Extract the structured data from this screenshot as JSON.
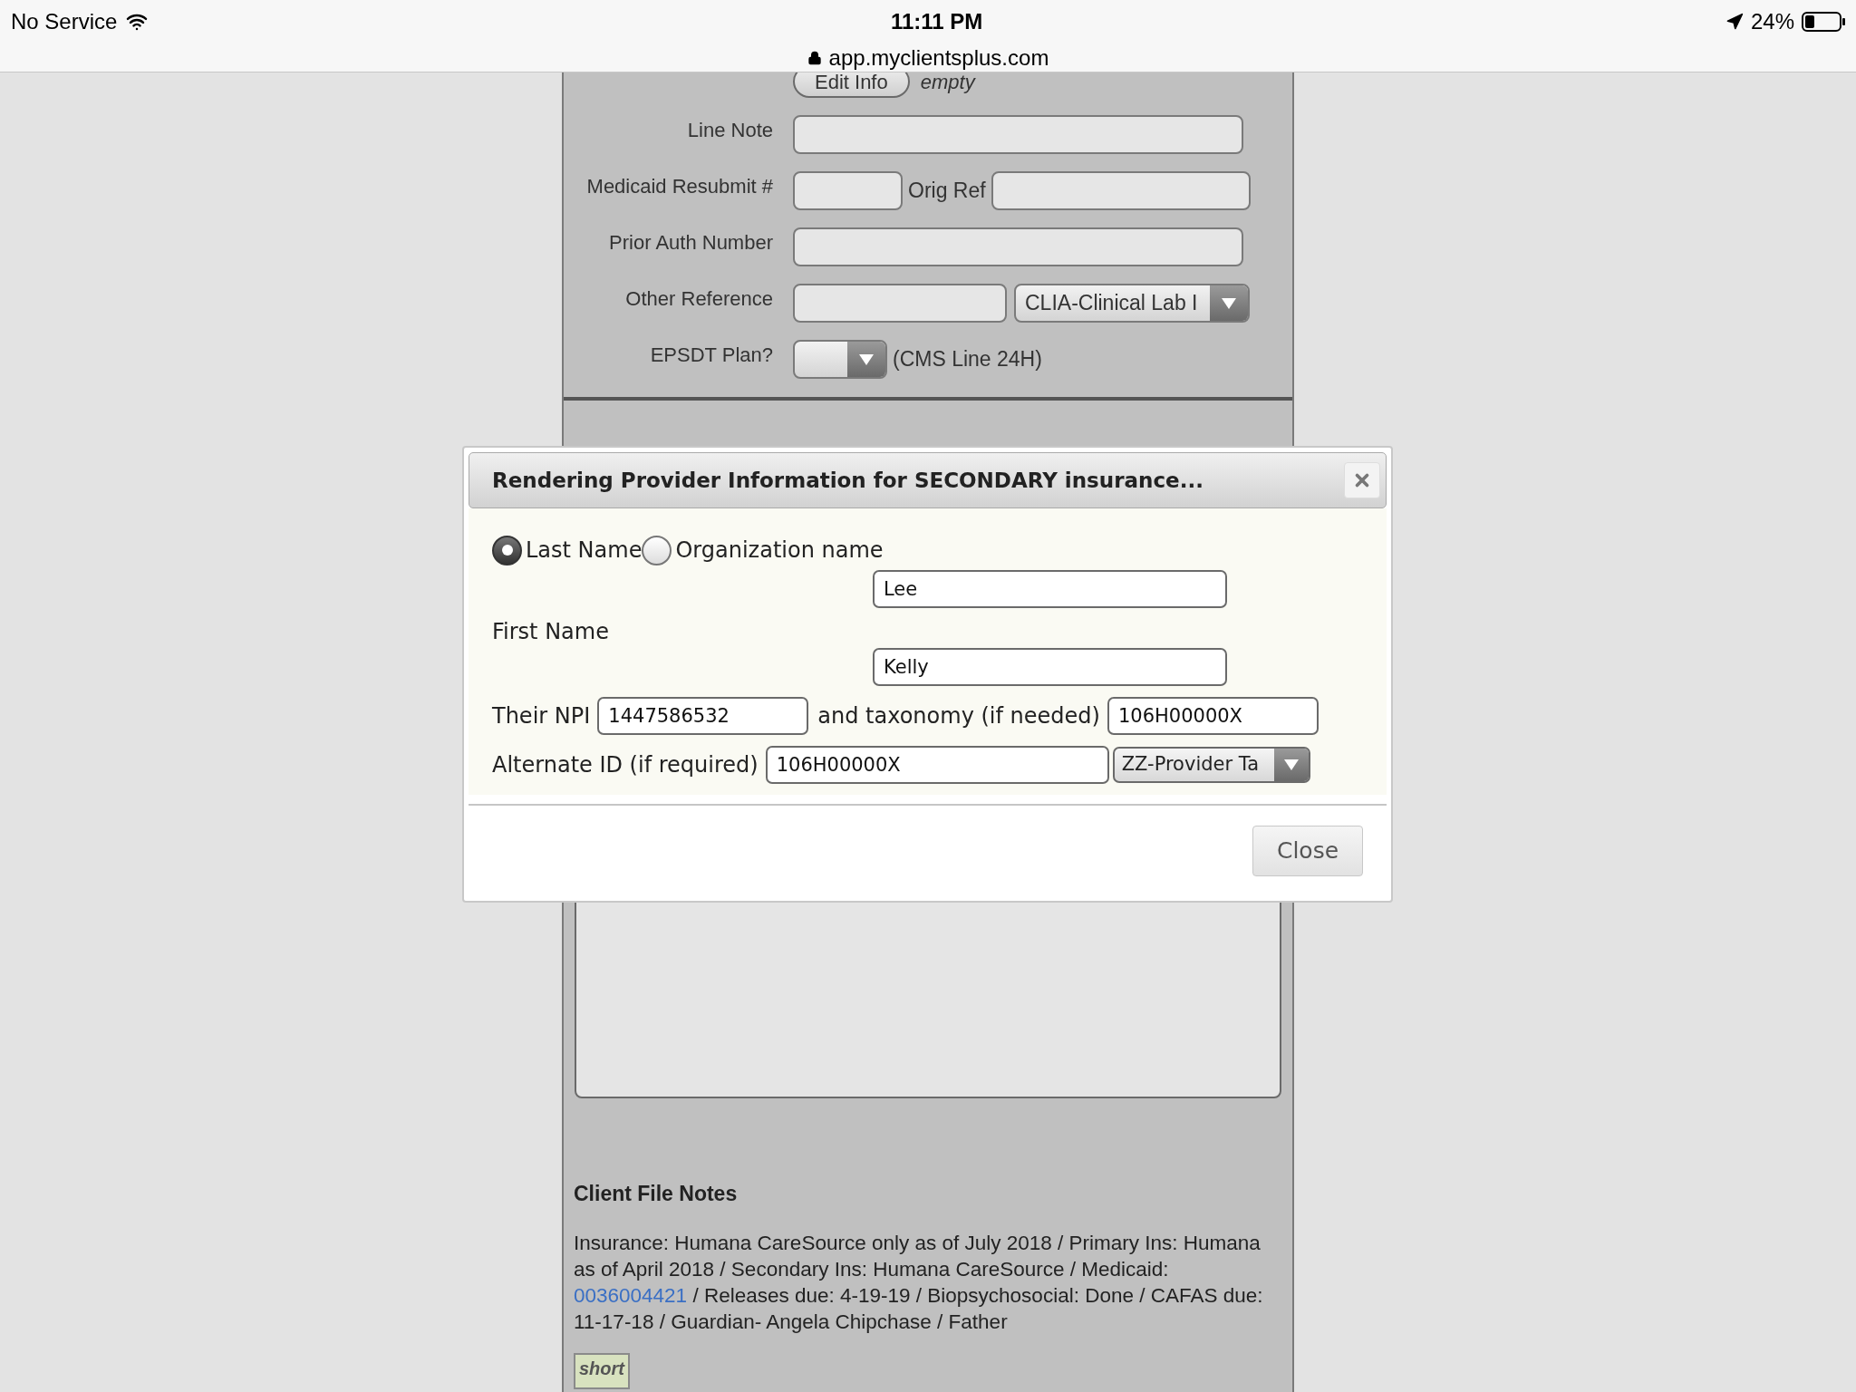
{
  "status_bar": {
    "carrier": "No Service",
    "time": "11:11 PM",
    "url": "app.myclientsplus.com",
    "battery": "24%"
  },
  "form": {
    "supervising_provider": {
      "button": "Edit Info",
      "value": "empty"
    },
    "rows": [
      {
        "kind": "text",
        "label": "Line Note"
      },
      {
        "kind": "pair",
        "label": "Medicaid Resubmit #",
        "second_label": "Orig Ref"
      },
      {
        "kind": "text",
        "label": "Prior Auth Number"
      },
      {
        "kind": "select",
        "label": "Other Reference",
        "select_value": "CLIA-Clinical Lab I"
      },
      {
        "kind": "plan",
        "label": "EPSDT Plan?",
        "note": "(CMS Line 24H)"
      }
    ]
  },
  "dialog": {
    "title": "Rendering Provider Information for SECONDARY insurance...",
    "name_type": [
      {
        "label": "Last Name",
        "selected": true
      },
      {
        "label": "Organization name",
        "selected": false
      }
    ],
    "last_name": "Lee",
    "first_name_label": "First Name",
    "first_name": "Kelly",
    "npi_label": "Their NPI",
    "npi": "1447586532",
    "taxonomy_label": "and taxonomy (if needed)",
    "taxonomy": "106H00000X",
    "alt_id_label": "Alternate ID (if required)",
    "alt_id": "106H00000X",
    "alt_id_type": "ZZ-Provider Ta",
    "close_button": "Close"
  },
  "notes": {
    "title": "Client File Notes",
    "text_before": "Insurance: Humana CareSource only as of July 2018 / Primary Ins: Humana as of April 2018 / Secondary Ins: Humana CareSource / Medicaid:",
    "link": "0036004421",
    "text_after": "/ Releases due: 4-19-19 / Biopsychosocial: Done / CAFAS due: 11-17-18 / Guardian- Angela Chipchase / Father",
    "short_button": "short"
  }
}
